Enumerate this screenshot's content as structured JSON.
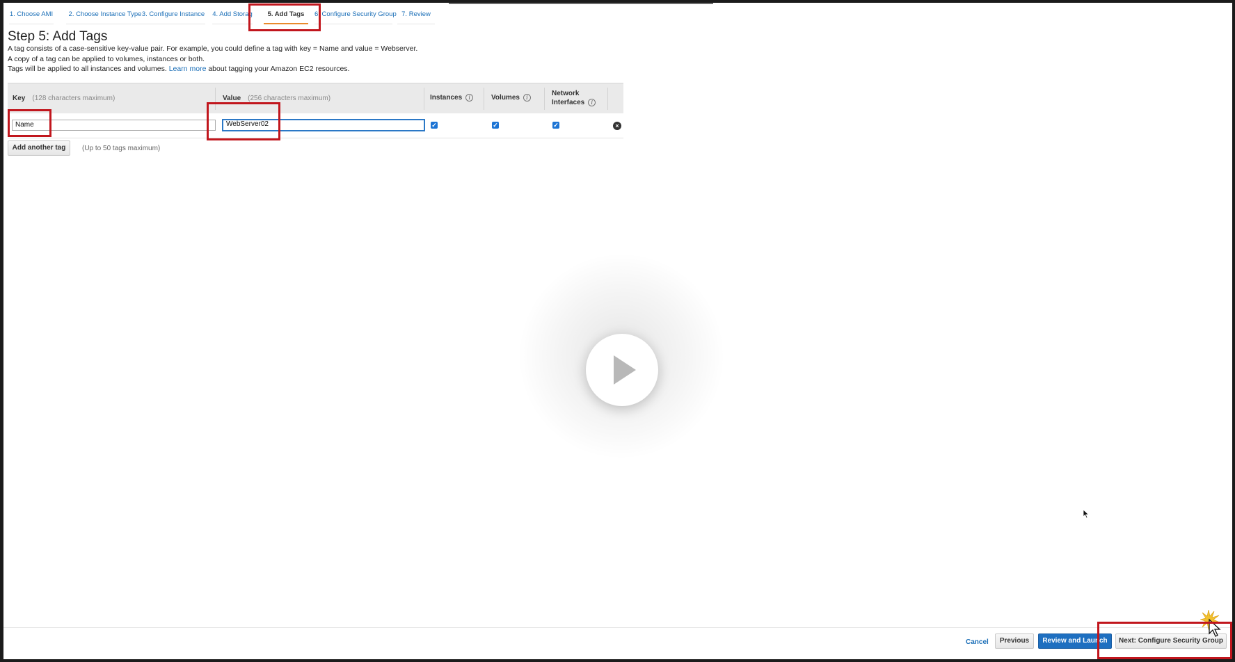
{
  "tabs": [
    {
      "label": "1. Choose AMI",
      "active": false
    },
    {
      "label": "2. Choose Instance Type",
      "active": false
    },
    {
      "label": "3. Configure Instance",
      "active": false
    },
    {
      "label": "4. Add Storag",
      "active": false
    },
    {
      "label": "5. Add Tags",
      "active": true
    },
    {
      "label": "6. Configure Security Group",
      "active": false
    },
    {
      "label": "7. Review",
      "active": false
    }
  ],
  "page": {
    "title": "Step 5: Add Tags",
    "desc_line1": "A tag consists of a case-sensitive key-value pair. For example, you could define a tag with key = Name and value = Webserver.",
    "desc_line2": "A copy of a tag can be applied to volumes, instances or both.",
    "desc_line3_prefix": "Tags will be applied to all instances and volumes.",
    "learn_more": "Learn more",
    "desc_line3_suffix": "about tagging your Amazon EC2 resources."
  },
  "table": {
    "key_header": "Key",
    "key_hint": "(128 characters maximum)",
    "value_header": "Value",
    "value_hint": "(256 characters maximum)",
    "instances_header": "Instances",
    "volumes_header": "Volumes",
    "network_header_line1": "Network",
    "network_header_line2": "Interfaces",
    "info_glyph": "i",
    "rows": [
      {
        "key": "Name",
        "value": "WebServer02",
        "instances": true,
        "volumes": true,
        "network_interfaces": true
      }
    ],
    "check_glyph": "✓",
    "remove_glyph": "×"
  },
  "add_tag": {
    "button_label": "Add another tag",
    "note": "(Up to 50 tags maximum)"
  },
  "footer": {
    "cancel": "Cancel",
    "previous": "Previous",
    "review_and_launch": "Review and Launch",
    "next": "Next: Configure Security Group"
  },
  "colors": {
    "primary_button": "#1e6fc0",
    "link": "#1a6eb7",
    "active_tab_underline": "#e98a2c",
    "highlight_box": "#c1161d",
    "checkbox": "#1c74d4"
  },
  "icons": {
    "info": "info-circle-icon",
    "remove": "remove-circle-icon",
    "play": "play-icon",
    "cursor": "mouse-pointer-icon",
    "click_burst": "click-burst-icon"
  }
}
